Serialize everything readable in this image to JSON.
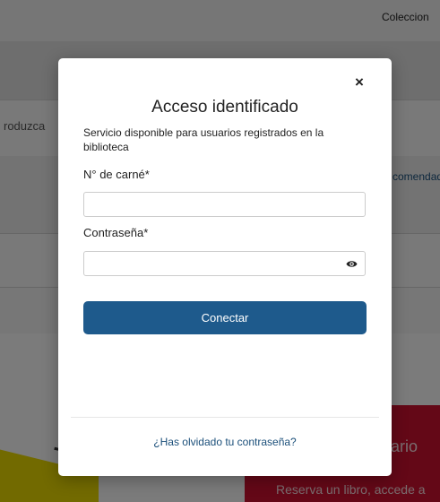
{
  "background": {
    "top_nav_text": "Coleccion",
    "left_field_text": "roduzca",
    "right_link_text": "comendad",
    "panel_title": "ario",
    "panel_subtitle": "Reserva un libro, accede a"
  },
  "modal": {
    "close_label": "×",
    "title": "Acceso identificado",
    "subtitle": "Servicio disponible para usuarios registrados en la biblioteca",
    "card_label": "N° de carné*",
    "card_value": "",
    "password_label": "Contraseña*",
    "password_value": "",
    "connect_label": "Conectar",
    "forgot_label": "¿Has olvidado tu contraseña?"
  },
  "colors": {
    "primary_button": "#1e5a8c",
    "link": "#1b4f7a",
    "panel_red": "#c8102e",
    "accent_yellow": "#e5d500"
  },
  "icons": {
    "close": "close-icon",
    "password_toggle": "eye-icon"
  }
}
